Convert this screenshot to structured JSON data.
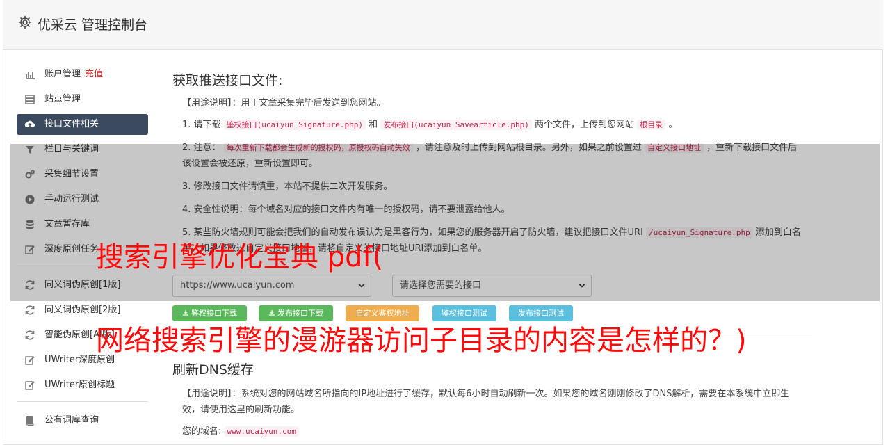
{
  "header": {
    "title": "优采云 管理控制台",
    "icon": "gear-icon"
  },
  "sidebar": {
    "items": [
      {
        "label": "账户管理",
        "badge": "充值",
        "icon": "bar-chart-icon"
      },
      {
        "label": "站点管理",
        "icon": "server-icon"
      },
      {
        "label": "接口文件相关",
        "icon": "cloud-upload-icon",
        "active": true
      },
      {
        "label": "栏目与关键词",
        "icon": "filter-icon"
      },
      {
        "label": "采集细节设置",
        "icon": "cogs-icon"
      },
      {
        "label": "手动运行测试",
        "icon": "play-circle-icon"
      },
      {
        "label": "文章暂存库",
        "icon": "database-icon"
      },
      {
        "label": "深度原创任务",
        "icon": "edit-icon"
      },
      {
        "label": "同义词伪原创[1版]",
        "icon": "refresh-icon"
      },
      {
        "label": "同义词伪原创[2版]",
        "icon": "refresh-icon"
      },
      {
        "label": "智能伪原创[AI版]",
        "icon": "refresh-icon"
      },
      {
        "label": "UWriter深度原创",
        "icon": "edit-icon"
      },
      {
        "label": "UWriter原创标题",
        "icon": "edit-icon"
      },
      {
        "label": "公有词库查询",
        "icon": "book-icon"
      }
    ]
  },
  "section1": {
    "title": "获取推送接口文件:",
    "usage": "【用途说明】：用于文章采集完毕后发送到您网站。",
    "item1": {
      "pre": "1. 请下载",
      "code1": "鉴权接口(ucaiyun_Signature.php)",
      "mid": "和",
      "code2": "发布接口(ucaiyun_Savearticle.php)",
      "post": "两个文件，上传到您网站",
      "code3": "根目录",
      "end": "。"
    },
    "item2": {
      "pre": "2. 注意：",
      "code1": "每次重新下载都会生成新的授权码，原授权码自动失效",
      "mid": "，请注意及时上传到网站根目录。另外，如果之前设置过",
      "code2": "自定义接口地址",
      "post": "，重新下载接口文件后该设置会被还原，重新设置即可。"
    },
    "item3": "3. 修改接口文件请慎重，本站不提供二次开发服务。",
    "item4": "4. 安全性说明：每个域名对应的接口文件内有唯一的授权码，请不要泄露给他人。",
    "item5": {
      "pre": "5. 某些防火墙规则可能会把我们的自动发布误认为是黑客行为，如果您的服务器开启了防火墙，建议把接口文件URI",
      "code1": "/ucaiyun_Signature.php",
      "post": "添加到白名单，如果修改过自定义接口地址，请将自定义的接口地址URI添加到白名单。"
    },
    "site_select": "https://www.ucaiyun.com",
    "interface_select": "请选择您需要的接口",
    "buttons": {
      "dl_signature": "鉴权接口下载",
      "dl_publish": "发布接口下载",
      "custom_url": "自定义鉴权地址",
      "test_signature": "鉴权接口测试",
      "test_publish": "发布接口测试"
    }
  },
  "section2": {
    "title": "刷新DNS缓存",
    "usage": "【用途说明】：系统对您的网站域名所指向的IP地址进行了缓存，默认每6小时自动刷新一次。如果您的域名刚刚修改了DNS解析，需要在本系统中立即生效，请使用这里的刷新功能。",
    "domain_label": "您的域名:",
    "domain_value": "www.ucaiyun.com"
  },
  "overlay_text": {
    "line1": "搜索引擎优化宝典 pdf(",
    "line2": "网络搜索引擎的漫游器访问子目录的内容是怎样的？)"
  },
  "colors": {
    "active_nav": "#3b4a5e",
    "badge": "#e02020",
    "overlay_text": "#ff0a0a",
    "code": "#c7254e"
  }
}
